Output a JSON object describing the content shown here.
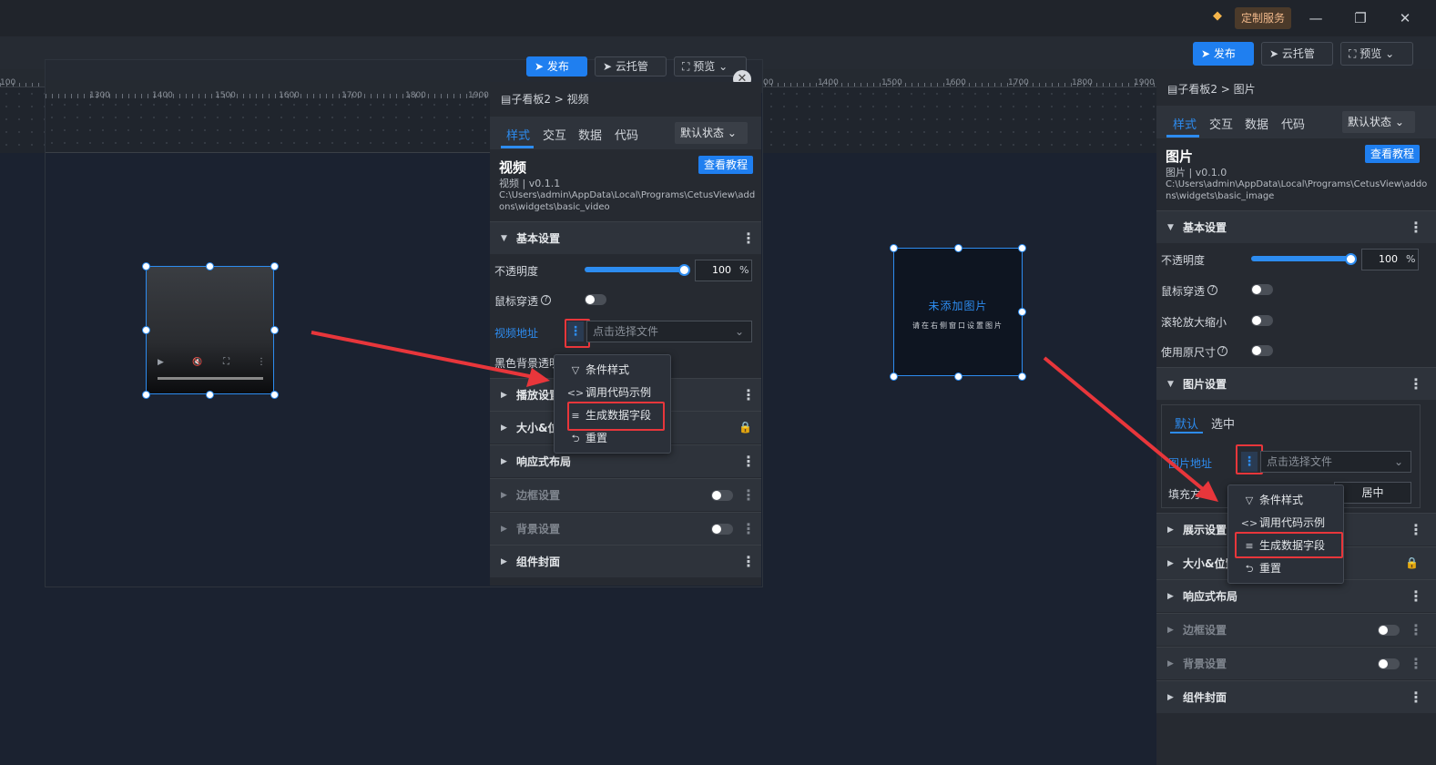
{
  "titlebar": {
    "service_label": "定制服务"
  },
  "toolbar": {
    "publish": "发布",
    "hosting": "云托管",
    "preview": "预览"
  },
  "ruler": {
    "labels": [
      "100",
      "1300",
      "1400",
      "1500",
      "1600",
      "1700",
      "1800",
      "1900"
    ],
    "labels_right": [
      "00",
      "1400",
      "1500",
      "1600",
      "1700",
      "1800",
      "1900"
    ]
  },
  "video_panel": {
    "breadcrumb": "子看板2 > 视频",
    "tabs": [
      "样式",
      "交互",
      "数据",
      "代码"
    ],
    "state": "默认状态",
    "widget_title": "视频",
    "widget_version": "视频 | v0.1.1",
    "widget_path": "C:\\Users\\admin\\AppData\\Local\\Programs\\CetusView\\addons\\widgets\\basic_video",
    "tutorial": "查看教程",
    "sections": [
      "基本设置",
      "播放设置",
      "大小&位置",
      "响应式布局",
      "边框设置",
      "背景设置",
      "组件封面"
    ],
    "opacity_label": "不透明度",
    "opacity_value": "100",
    "percent": "%",
    "mouse_through": "鼠标穿透",
    "video_url_label": "视频地址",
    "file_placeholder": "点击选择文件",
    "black_bg": "黑色背景透明"
  },
  "context_menu": {
    "items": [
      "条件样式",
      "调用代码示例",
      "生成数据字段",
      "重置"
    ]
  },
  "image_placeholder": {
    "title": "未添加图片",
    "hint": "请在右侧窗口设置图片"
  },
  "image_panel": {
    "breadcrumb": "子看板2 > 图片",
    "tabs": [
      "样式",
      "交互",
      "数据",
      "代码"
    ],
    "state": "默认状态",
    "widget_title": "图片",
    "widget_version": "图片 | v0.1.0",
    "widget_path": "C:\\Users\\admin\\AppData\\Local\\Programs\\CetusView\\addons\\widgets\\basic_image",
    "tutorial": "查看教程",
    "sections": [
      "基本设置",
      "图片设置",
      "展示设置",
      "大小&位置",
      "响应式布局",
      "边框设置",
      "背景设置",
      "组件封面"
    ],
    "opacity_label": "不透明度",
    "opacity_value": "100",
    "percent": "%",
    "mouse_through": "鼠标穿透",
    "wheel_zoom": "滚轮放大缩小",
    "original_size": "使用原尺寸",
    "sub_tabs": [
      "默认",
      "选中"
    ],
    "image_url_label": "图片地址",
    "file_placeholder": "点击选择文件",
    "fill_label": "填充方",
    "fill_value": "居中"
  },
  "colors": {
    "accent": "#2d8cf0",
    "highlight": "#e8363b",
    "panel": "#262a31"
  }
}
